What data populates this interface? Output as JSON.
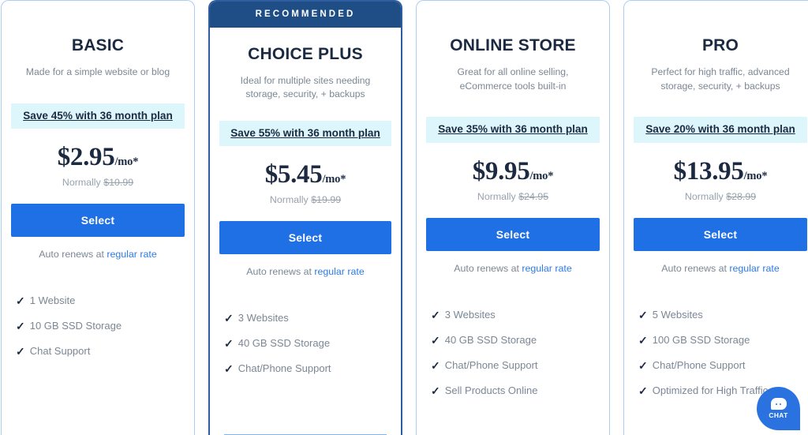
{
  "colors": {
    "accent_blue": "#1f6fe5",
    "recommended_navy": "#1f4e87",
    "save_banner_bg": "#ddf6fb",
    "card_border": "#a9cdf3",
    "link_blue": "#2f7ae5",
    "text_navy": "#1b2a41",
    "text_gray": "#7b8794"
  },
  "common": {
    "select_label": "Select",
    "autorenew_prefix": "Auto renews at ",
    "autorenew_link": "regular rate",
    "normally_prefix": "Normally ",
    "period_suffix": "/mo*",
    "check_icon": "✓"
  },
  "plans": [
    {
      "badge": "",
      "recommended": false,
      "title": "BASIC",
      "subtitle": "Made for a simple website or blog",
      "save_text": "Save 45% with 36 month plan",
      "price": "$2.95",
      "period": "/mo*",
      "normally_price": "$10.99",
      "features": [
        "1 Website",
        "10 GB SSD Storage",
        "Chat Support"
      ]
    },
    {
      "badge": "RECOMMENDED",
      "recommended": true,
      "title": "CHOICE PLUS",
      "subtitle": "Ideal for multiple sites needing storage, security, + backups",
      "save_text": "Save 55% with 36 month plan",
      "price": "$5.45",
      "period": "/mo*",
      "normally_price": "$19.99",
      "features": [
        "3 Websites",
        "40 GB SSD Storage",
        "Chat/Phone Support"
      ]
    },
    {
      "badge": "",
      "recommended": false,
      "title": "ONLINE STORE",
      "subtitle": "Great for all online selling, eCommerce tools built-in",
      "save_text": "Save 35% with 36 month plan",
      "price": "$9.95",
      "period": "/mo*",
      "normally_price": "$24.95",
      "features": [
        "3 Websites",
        "40 GB SSD Storage",
        "Chat/Phone Support",
        "Sell Products Online"
      ]
    },
    {
      "badge": "",
      "recommended": false,
      "title": "PRO",
      "subtitle": "Perfect for high traffic, advanced storage, security, + backups",
      "save_text": "Save 20% with 36 month plan",
      "price": "$13.95",
      "period": "/mo*",
      "normally_price": "$28.99",
      "features": [
        "5 Websites",
        "100 GB SSD Storage",
        "Chat/Phone Support",
        "Optimized for High Traffic"
      ]
    }
  ],
  "chat_widget": {
    "label": "CHAT",
    "icon": "chat-bubble-icon"
  }
}
